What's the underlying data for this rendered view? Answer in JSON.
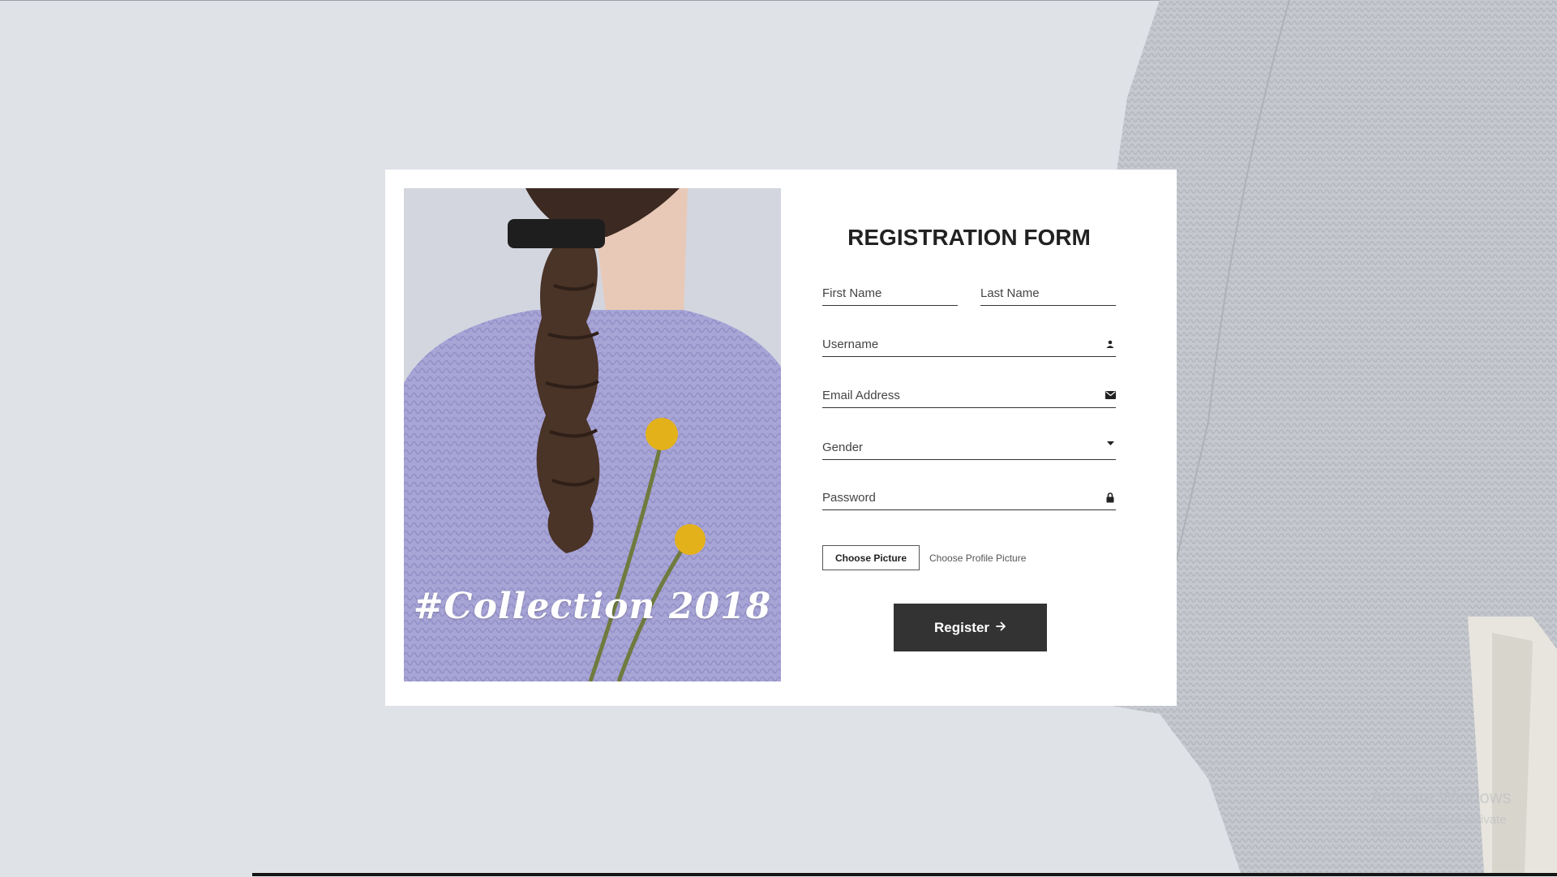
{
  "page": {
    "background": "#dfe3e8"
  },
  "form": {
    "title": "REGISTRATION FORM",
    "first_name_placeholder": "First Name",
    "last_name_placeholder": "Last Name",
    "username_placeholder": "Username",
    "email_placeholder": "Email Address",
    "gender_label": "Gender",
    "password_placeholder": "Password",
    "choose_picture_label": "Choose Picture",
    "profile_picture_text": "Choose Profile Picture",
    "register_label": "Register"
  },
  "photo": {
    "caption": "#Collection 2018"
  },
  "watermark": {
    "line1": "Activate Windows",
    "line2": "Go to Settings to activate Windows."
  },
  "icons": {
    "username": "user-icon",
    "email": "envelope-icon",
    "gender": "caret-down-icon",
    "password": "lock-icon",
    "register": "arrow-right-icon"
  },
  "colors": {
    "button": "#333333",
    "card": "#ffffff",
    "sweater": "#a7a4d6",
    "flower": "#e3b11a"
  }
}
